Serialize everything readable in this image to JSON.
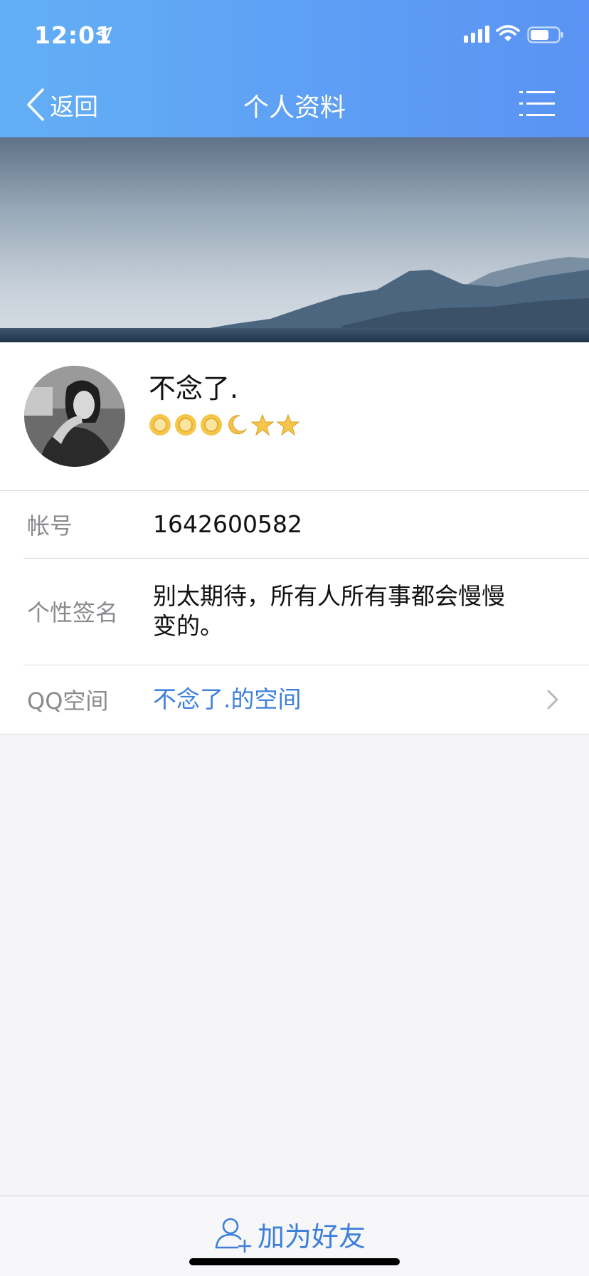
{
  "status_bar": {
    "time": "12:01",
    "icons": [
      "location-arrow-icon",
      "signal-icon",
      "wifi-icon",
      "battery-icon"
    ]
  },
  "nav": {
    "back_label": "返回",
    "title": "个人资料",
    "menu_icon": "list-menu-icon",
    "gradient_colors": [
      "#63aff5",
      "#5a93f3"
    ]
  },
  "cover": {
    "image": "mountain-sea-landscape"
  },
  "profile": {
    "nickname": "不念了.",
    "level_icons": [
      "sun-icon",
      "sun-icon",
      "sun-icon",
      "moon-icon",
      "star-icon",
      "star-icon"
    ]
  },
  "info": {
    "account_label": "帐号",
    "account_value": "1642600582",
    "signature_label": "个性签名",
    "signature_value": "别太期待，所有人所有事都会慢慢变的。",
    "qzone_label": "QQ空间",
    "qzone_value": "不念了.的空间"
  },
  "bottom": {
    "add_friend_label": "加为好友",
    "accent_color": "#3d7fdb"
  }
}
